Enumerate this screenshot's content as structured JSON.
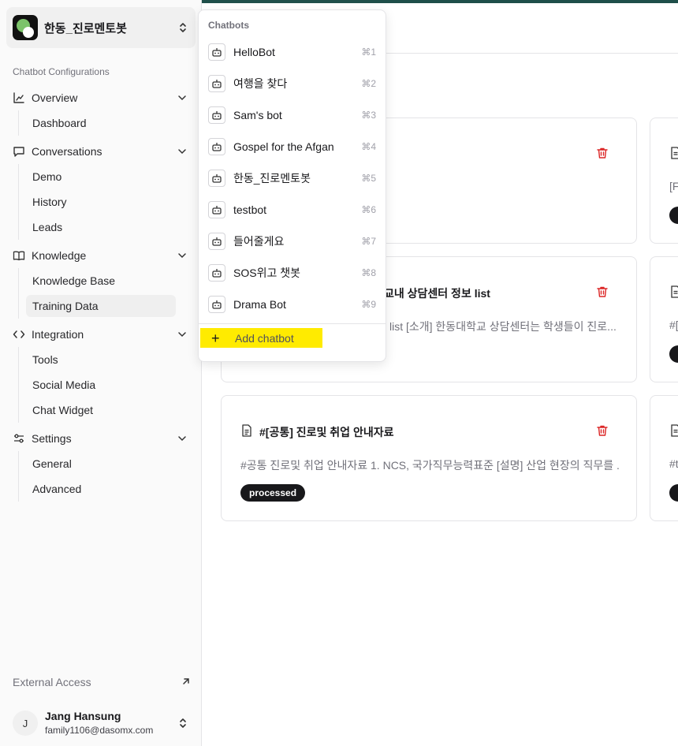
{
  "sidebar": {
    "bot_name": "한동_진로멘토봇",
    "section_label": "Chatbot Configurations",
    "groups": [
      {
        "label": "Overview",
        "items": [
          "Dashboard"
        ]
      },
      {
        "label": "Conversations",
        "items": [
          "Demo",
          "History",
          "Leads"
        ]
      },
      {
        "label": "Knowledge",
        "items": [
          "Knowledge Base",
          "Training Data"
        ]
      },
      {
        "label": "Integration",
        "items": [
          "Tools",
          "Social Media",
          "Chat Widget"
        ]
      },
      {
        "label": "Settings",
        "items": [
          "General",
          "Advanced"
        ]
      }
    ],
    "active_item": "Training Data",
    "external_access": "External Access",
    "user": {
      "initial": "J",
      "name": "Jang Hansung",
      "email": "family1106@dasomx.com"
    }
  },
  "dropdown": {
    "label": "Chatbots",
    "items": [
      {
        "name": "HelloBot",
        "shortcut": "⌘1"
      },
      {
        "name": "여행을 찾다",
        "shortcut": "⌘2"
      },
      {
        "name": "Sam's bot",
        "shortcut": "⌘3"
      },
      {
        "name": "Gospel for the Afgan",
        "shortcut": "⌘4"
      },
      {
        "name": "한동_진로멘토봇",
        "shortcut": "⌘5"
      },
      {
        "name": "testbot",
        "shortcut": "⌘6"
      },
      {
        "name": "들어줄게요",
        "shortcut": "⌘7"
      },
      {
        "name": "SOS위고 챗봇",
        "shortcut": "⌘8"
      },
      {
        "name": "Drama Bot",
        "shortcut": "⌘9"
      }
    ],
    "add_label": "Add chatbot",
    "add_highlight_color": "#ffeb00"
  },
  "cards": [
    {
      "title": "",
      "desc": "",
      "badge": ""
    },
    {
      "title": "교내 상담센터 정보 list",
      "desc": "list [소개] 한동대학교 상담센터는 학생들이 진로...",
      "badge": ""
    },
    {
      "title": "#[공통] 진로및 취업 안내자료",
      "desc": "#공통 진로및 취업 안내자료 1. NCS, 국가직무능력표준 [설명] 산업 현장의 직무를 ...",
      "badge": "processed"
    }
  ],
  "right_cards": [
    {
      "desc": "[F"
    },
    {
      "desc": "#["
    },
    {
      "desc": "#t"
    }
  ],
  "colors": {
    "accent_bar": "#1f4f4a",
    "delete": "#dc2626",
    "badge": "#18181b"
  }
}
